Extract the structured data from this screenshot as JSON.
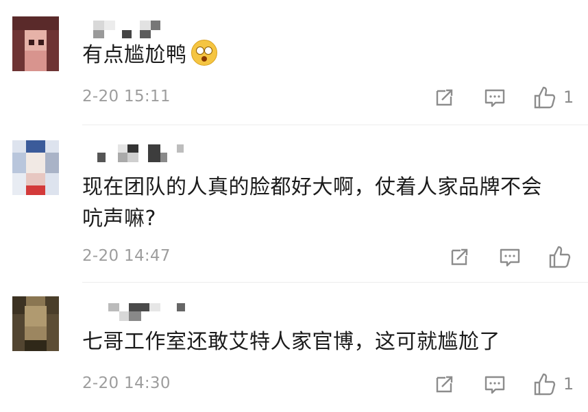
{
  "comments": [
    {
      "text": "有点尴尬鸭",
      "has_emoji": true,
      "emoji": "astonished-face",
      "time": "2-20 15:11",
      "like_count": "1"
    },
    {
      "text_line1": "现在团队的人真的脸都好大啊，仗着人家品牌不会",
      "text_line2": "吭声嘛?",
      "time": "2-20 14:47",
      "like_count": ""
    },
    {
      "text": "七哥工作室还敢艾特人家官博，这可就尴尬了",
      "time": "2-20 14:30",
      "like_count": "1"
    }
  ],
  "icons": {
    "share": "share-icon",
    "comment": "comment-icon",
    "like": "thumbs-up-icon"
  },
  "colors": {
    "text": "#1b1b1b",
    "meta": "#9d9d9d",
    "icon": "#8c8c8c"
  }
}
